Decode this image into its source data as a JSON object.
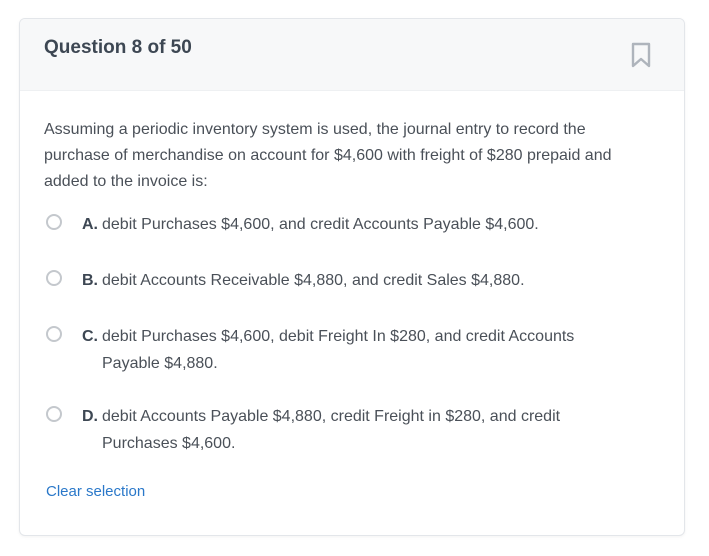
{
  "header": {
    "title": "Question 8 of 50",
    "bookmark_icon": "bookmark-icon"
  },
  "question": {
    "text": "Assuming a periodic inventory system is used, the journal entry to record the purchase of merchandise on account for $4,600 with freight of $280 prepaid and added to the invoice is:"
  },
  "options": [
    {
      "letter": "A.",
      "text": "debit Purchases $4,600, and credit Accounts Payable $4,600.",
      "selected": false
    },
    {
      "letter": "B.",
      "text": "debit Accounts Receivable $4,880, and credit Sales $4,880.",
      "selected": false
    },
    {
      "letter": "C.",
      "text": "debit Purchases $4,600, debit Freight In $280, and credit Accounts Payable $4,880.",
      "selected": false
    },
    {
      "letter": "D.",
      "text": "debit Accounts Payable $4,880, credit Freight in $280, and credit Purchases $4,600.",
      "selected": false
    }
  ],
  "actions": {
    "clear_label": "Clear selection"
  },
  "colors": {
    "link": "#2a78c9",
    "title": "#3d4753",
    "body_text": "#4a5058",
    "radio_border": "#c4c8cd",
    "header_bg": "#f7f8f9"
  }
}
